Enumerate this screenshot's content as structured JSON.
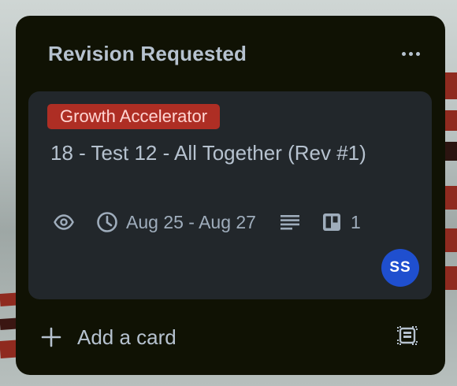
{
  "list": {
    "title": "Revision Requested",
    "more_icon": "more-horizontal-icon",
    "add_card_label": "Add a card",
    "add_icon": "plus-icon",
    "template_icon": "card-template-icon"
  },
  "card": {
    "label": "Growth Accelerator",
    "label_color": "#ae2e24",
    "title": "18 - Test 12 - All Together (Rev #1)",
    "badges": {
      "watch_icon": "eye-icon",
      "dates_icon": "clock-icon",
      "dates": "Aug 25 - Aug 27",
      "description_icon": "description-lines-icon",
      "checklist_icon": "checklist-board-icon",
      "checklist_count": "1"
    },
    "member": {
      "initials": "SS",
      "color": "#1f4fcf"
    }
  }
}
